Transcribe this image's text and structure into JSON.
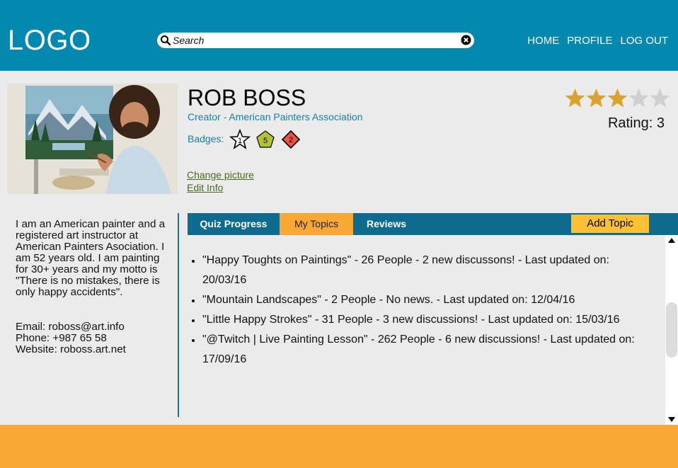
{
  "header": {
    "logo": "LOGO",
    "search_placeholder": "Search",
    "nav": {
      "home": "HOME",
      "profile": "PROFILE",
      "logout": "LOG OUT"
    }
  },
  "profile": {
    "name": "ROB BOSS",
    "role": "Creator - American Painters Association",
    "badges_label": "Badges:",
    "badges": [
      {
        "shape": "star",
        "value": "1",
        "color": "#ffffff"
      },
      {
        "shape": "pentagon",
        "value": "5",
        "color": "#b5c234"
      },
      {
        "shape": "diamond",
        "value": "2",
        "color": "#ef5146"
      }
    ],
    "change_picture": "Change picture",
    "edit_info": "Edit Info",
    "rating_value": 3,
    "rating_max": 5,
    "rating_label": "Rating: 3",
    "star_color": "#dba22f"
  },
  "bio": {
    "text": "I am an American painter and a registered art instructor at American Painters Asociation. I am 52 years old. I am painting for 30+ years and my motto is \"There is no mistakes, there is only happy accidents\".",
    "email": "Email: roboss@art.info",
    "phone": "Phone: +987 65 58",
    "website": "Website: roboss.art.net"
  },
  "tabs": {
    "items": [
      "Quiz Progress",
      "My Topics",
      "Reviews"
    ],
    "active": "My Topics",
    "add_topic": "Add Topic"
  },
  "topics": [
    "\"Happy Toughts on Paintings\" - 26 People - 2 new discussons! - Last updated on: 20/03/16",
    "\"Mountain Landscapes\" - 2 People - No news. - Last updated on: 12/04/16",
    "\"Little Happy Strokes\" - 31 People - 3 new discussions! - Last updated on: 15/03/16",
    "\"@Twitch | Live Painting Lesson\" - 262 People - 6 new discussions! - Last updated on: 17/09/16"
  ],
  "colors": {
    "header": "#0388b0",
    "accent": "#fba733",
    "tabbar": "#0f6b8e",
    "add_topic": "#fcc034"
  }
}
